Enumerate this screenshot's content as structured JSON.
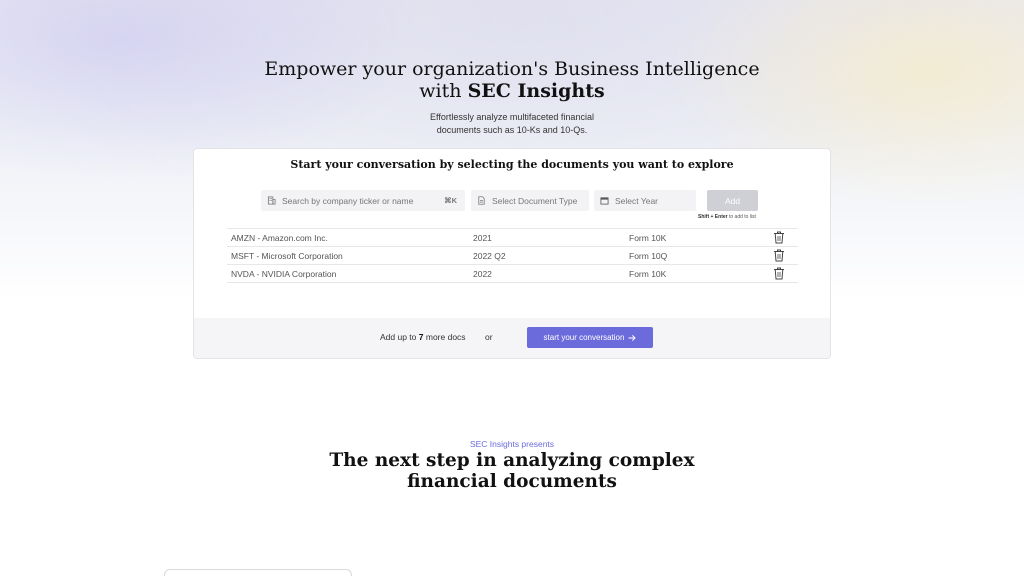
{
  "hero": {
    "title_line1": "Empower your organization's Business Intelligence",
    "title_line2_prefix": "with ",
    "title_brand": "SEC Insights",
    "subtitle_line1": "Effortlessly analyze multifaceted financial",
    "subtitle_line2": "documents such as 10-Ks and 10-Qs."
  },
  "selector": {
    "title": "Start your conversation by selecting the documents you want to explore",
    "search_placeholder": "Search by company ticker or name",
    "search_shortcut": "⌘K",
    "doctype_placeholder": "Select Document Type",
    "year_placeholder": "Select Year",
    "add_label": "Add",
    "hint_keys": "Shift + Enter",
    "hint_text": " to add to list",
    "documents": [
      {
        "company": "AMZN - Amazon.com Inc.",
        "period": "2021",
        "form": "Form 10K"
      },
      {
        "company": "MSFT - Microsoft Corporation",
        "period": "2022 Q2",
        "form": "Form 10Q"
      },
      {
        "company": "NVDA - NVIDIA Corporation",
        "period": "2022",
        "form": "Form 10K"
      }
    ],
    "footer": {
      "add_prefix": "Add up to ",
      "add_count": "7",
      "add_suffix": " more docs",
      "or": "or",
      "start_label": "start your conversation"
    }
  },
  "section": {
    "eyebrow": "SEC Insights presents",
    "title_line1": "The next step in analyzing complex",
    "title_line2": "financial documents"
  },
  "colors": {
    "accent": "#6c6bdc",
    "add_disabled": "#cfcfd6"
  },
  "icons": {
    "search": "building-icon",
    "doctype": "document-icon",
    "year": "calendar-icon",
    "remove": "trash-icon",
    "start": "arrow-right-icon"
  }
}
